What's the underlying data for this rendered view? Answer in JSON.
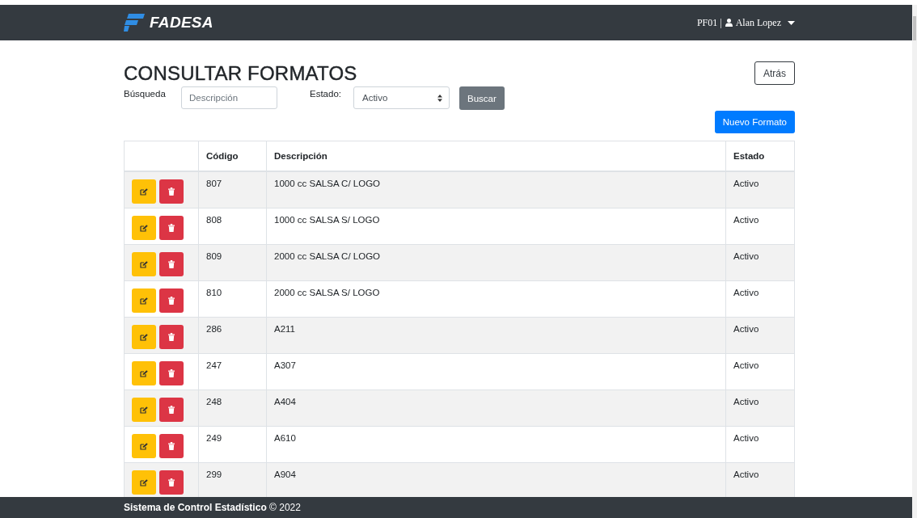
{
  "navbar": {
    "brand": "FADESA",
    "station": "PF01 |",
    "user": "Alan Lopez"
  },
  "page": {
    "title": "CONSULTAR FORMATOS",
    "back_button": "Atrás",
    "search": {
      "label": "Búsqueda",
      "placeholder": "Descripción"
    },
    "status_filter": {
      "label": "Estado:",
      "value": "Activo"
    },
    "search_button": "Buscar",
    "new_button": "Nuevo Formato"
  },
  "table": {
    "columns": [
      "Código",
      "Descripción",
      "Estado"
    ],
    "rows": [
      {
        "code": "807",
        "description": "1000 cc SALSA C/ LOGO",
        "status": "Activo"
      },
      {
        "code": "808",
        "description": "1000 cc SALSA S/ LOGO",
        "status": "Activo"
      },
      {
        "code": "809",
        "description": "2000 cc SALSA C/ LOGO",
        "status": "Activo"
      },
      {
        "code": "810",
        "description": "2000 cc SALSA S/ LOGO",
        "status": "Activo"
      },
      {
        "code": "286",
        "description": "A211",
        "status": "Activo"
      },
      {
        "code": "247",
        "description": "A307",
        "status": "Activo"
      },
      {
        "code": "248",
        "description": "A404",
        "status": "Activo"
      },
      {
        "code": "249",
        "description": "A610",
        "status": "Activo"
      },
      {
        "code": "299",
        "description": "A904",
        "status": "Activo"
      }
    ]
  },
  "footer": {
    "text": "**Sistema de Control Estadístico** © 2022"
  }
}
